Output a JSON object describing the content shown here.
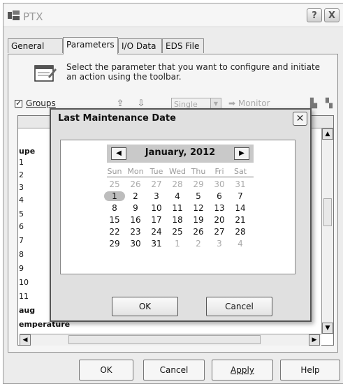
{
  "window": {
    "title": "PTX",
    "help_btn": "?",
    "close_btn": "X"
  },
  "tabs": [
    {
      "label": "General"
    },
    {
      "label": "Parameters"
    },
    {
      "label": "I/O Data"
    },
    {
      "label": "EDS File"
    }
  ],
  "instructions": "Select the parameter that you want to configure and initiate an action using the toolbar.",
  "toolbar": {
    "groups_label": "Groups",
    "groups_checked": true,
    "mode_value": "Single",
    "monitor_label": "Monitor"
  },
  "grid": {
    "row_labels": [
      "upe",
      "1",
      "2",
      "3",
      "4",
      "5",
      "6",
      "7",
      "8",
      "9",
      "10",
      "11",
      "aug",
      "emperature"
    ]
  },
  "dialog": {
    "title": "Last Maintenance Date",
    "month_label": "January, 2012",
    "weekdays": [
      "Sun",
      "Mon",
      "Tue",
      "Wed",
      "Thu",
      "Fri",
      "Sat"
    ],
    "weeks": [
      [
        "25",
        "26",
        "27",
        "28",
        "29",
        "30",
        "31"
      ],
      [
        "1",
        "2",
        "3",
        "4",
        "5",
        "6",
        "7"
      ],
      [
        "8",
        "9",
        "10",
        "11",
        "12",
        "13",
        "14"
      ],
      [
        "15",
        "16",
        "17",
        "18",
        "19",
        "20",
        "21"
      ],
      [
        "22",
        "23",
        "24",
        "25",
        "26",
        "27",
        "28"
      ],
      [
        "29",
        "30",
        "31",
        "1",
        "2",
        "3",
        "4"
      ]
    ],
    "ok_label": "OK",
    "cancel_label": "Cancel"
  },
  "buttons": {
    "ok": "OK",
    "cancel": "Cancel",
    "apply": "Apply",
    "help": "Help"
  }
}
